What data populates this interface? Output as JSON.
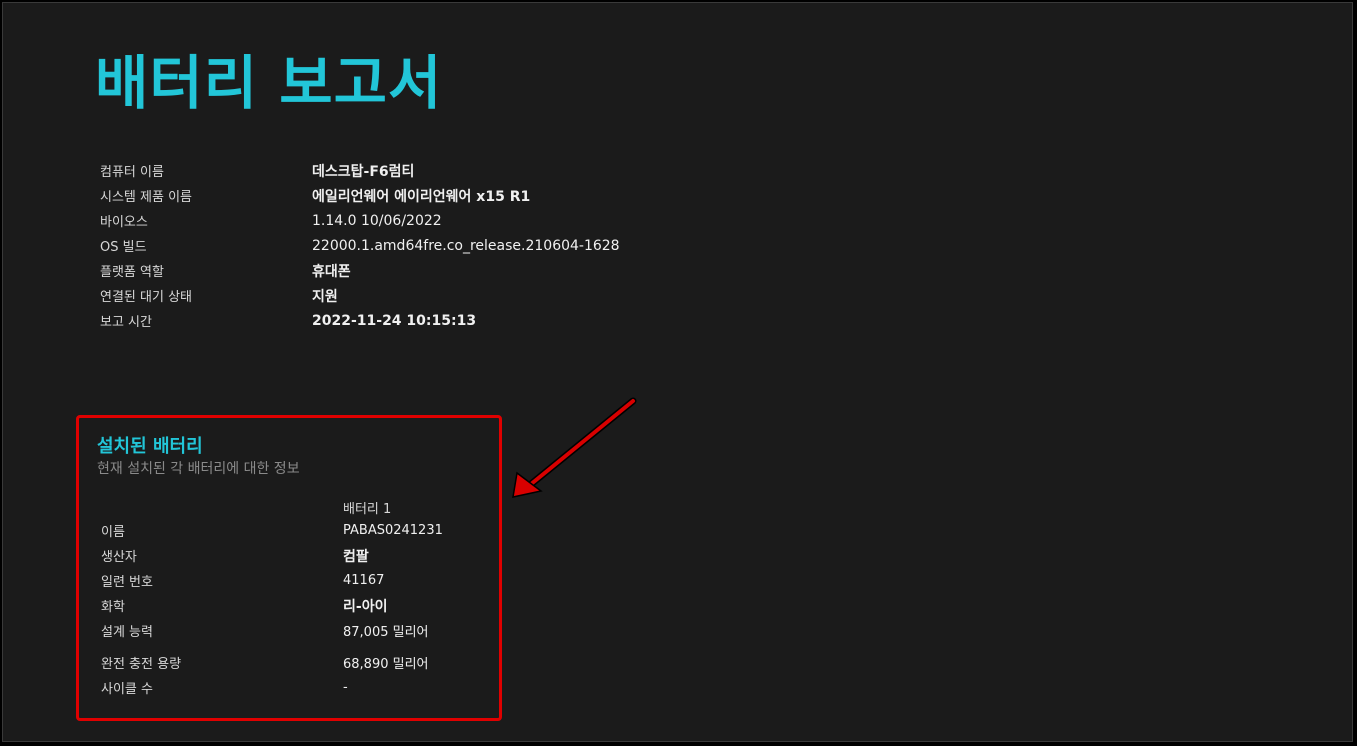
{
  "report": {
    "title": "배터리 보고서"
  },
  "system_info": [
    {
      "label": "컴퓨터 이름",
      "value": "데스크탑-F6럼티"
    },
    {
      "label": "시스템 제품 이름",
      "value": "에일리언웨어 에이리언웨어 x15 R1"
    },
    {
      "label": "바이오스",
      "value": "1.14.0 10/06/2022"
    },
    {
      "label": "OS 빌드",
      "value": "22000.1.amd64fre.co_release.210604-1628"
    },
    {
      "label": "플랫폼 역할",
      "value": "휴대폰"
    },
    {
      "label": "연결된 대기 상태",
      "value": "지원"
    },
    {
      "label": "보고 시간",
      "value": "2022-11-24  10:15:13"
    }
  ],
  "installed_batteries": {
    "title": "설치된 배터리",
    "subtitle": "현재 설치된 각 배터리에 대한 정보",
    "column_header": "배터리 1",
    "rows": [
      {
        "label": "이름",
        "value": "PABAS0241231"
      },
      {
        "label": "생산자",
        "value": "컴팔"
      },
      {
        "label": "일련 번호",
        "value": "41167"
      },
      {
        "label": "화학",
        "value": "리-아이"
      },
      {
        "label": "설계 능력",
        "value": "87,005 밀리어"
      },
      {
        "label": "완전 충전 용량",
        "value": "68,890 밀리어"
      },
      {
        "label": "사이클 수",
        "value": "-"
      }
    ]
  },
  "colors": {
    "accent": "#22c6d8",
    "highlight": "#e00000",
    "background": "#1b1b1b"
  }
}
